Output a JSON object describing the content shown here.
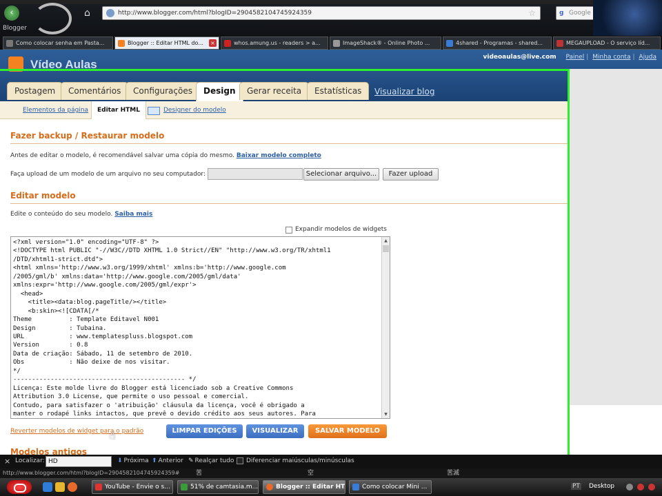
{
  "browser": {
    "address": "http://www.blogger.com/html?blogID=2904582104745924359",
    "search_placeholder": "Google",
    "bookmark": "Blogger",
    "tabs": [
      {
        "label": "Como colocar senha em Pasta..."
      },
      {
        "label": "Blogger :: Editar HTML do...",
        "active": true
      },
      {
        "label": "whos.amung.us - readers > a..."
      },
      {
        "label": "ImageShack® - Online Photo ..."
      },
      {
        "label": "4shared - Programas - shared..."
      },
      {
        "label": "MEGAUPLOAD - O serviço líd..."
      }
    ]
  },
  "header": {
    "brand": "Vídeo Aulas",
    "email": "videoaulas@live.com",
    "links": [
      "Painel",
      "Minha conta",
      "Ajuda"
    ]
  },
  "nav": {
    "tabs": [
      "Postagem",
      "Comentários",
      "Configurações",
      "Design",
      "Gerar receita",
      "Estatísticas"
    ],
    "view_blog": "Visualizar blog"
  },
  "subnav": {
    "elements": "Elementos da página",
    "edit_html": "Editar HTML",
    "designer": "Designer do modelo"
  },
  "backup": {
    "title": "Fazer backup / Restaurar modelo",
    "intro": "Antes de editar o modelo, é recomendável salvar uma cópia do mesmo.",
    "download_link": "Baixar modelo completo",
    "upload_label": "Faça upload de um modelo de um arquivo no seu computador:",
    "select_button": "Selecionar arquivo...",
    "upload_button": "Fazer upload"
  },
  "edit": {
    "title": "Editar modelo",
    "intro": "Edite o conteúdo do seu modelo.",
    "learn_more": "Saiba mais",
    "expand_widgets": "Expandir modelos de widgets",
    "code": "<?xml version=\"1.0\" encoding=\"UTF-8\" ?>\n<!DOCTYPE html PUBLIC \"-//W3C//DTD XHTML 1.0 Strict//EN\" \"http://www.w3.org/TR/xhtml1\n/DTD/xhtml1-strict.dtd\">\n<html xmlns='http://www.w3.org/1999/xhtml' xmlns:b='http://www.google.com\n/2005/gml/b' xmlns:data='http://www.google.com/2005/gml/data'\nxmlns:expr='http://www.google.com/2005/gml/expr'>\n  <head>\n    <title><data:blog.pageTitle/></title>\n    <b:skin><![CDATA[/*\nTheme          : Template Editavel N001\nDesign         : Tubaina.\nURL            : www.templatespluss.blogspot.com\nVersion        : 0.8\nData de criação: Sábado, 11 de setembro de 2010.\nObs            : Não deixe de nos visitar.\n*/\n---------------------------------------------- */\nLicença: Este molde livre do Blogger está licenciado sob a Creative Commons\nAttribution 3.0 License, que permite o uso pessoal e comercial.\nContudo, para satisfazer o 'atribuição' cláusula da licença, você é obrigado a\nmanter o rodapé links intactos, que prevê o devido crédito aos seus autores. Para",
    "revert_link": "Reverter modelos de widget para o padrão",
    "clear_button": "LIMPAR EDIÇÕES",
    "preview_button": "VISUALIZAR",
    "save_button": "SALVAR MODELO"
  },
  "old_models_title": "Modelos antigos",
  "findbar": {
    "label": "Localizar:",
    "value": "HD",
    "next": "Próxima",
    "previous": "Anterior",
    "highlight": "Realçar tudo",
    "match_case": "Diferenciar maiúsculas/minúsculas"
  },
  "status": {
    "url": "http://www.blogger.com/html?blogID=2904582104745924359#",
    "cjk": [
      "苦",
      "空",
      "苦滅"
    ]
  },
  "taskbar": {
    "tasks": [
      {
        "label": "YouTube - Envie o s..."
      },
      {
        "label": "51% de camtasia.m..."
      },
      {
        "label": "Blogger :: Editar HT...",
        "active": true
      },
      {
        "label": "Como colocar Mini ..."
      }
    ],
    "pt": "PT",
    "desktop": "Desktop"
  },
  "colors": {
    "accent_orange": "#d76c1a",
    "header_blue": "#1b4275",
    "highlight_green": "#2df02d"
  }
}
